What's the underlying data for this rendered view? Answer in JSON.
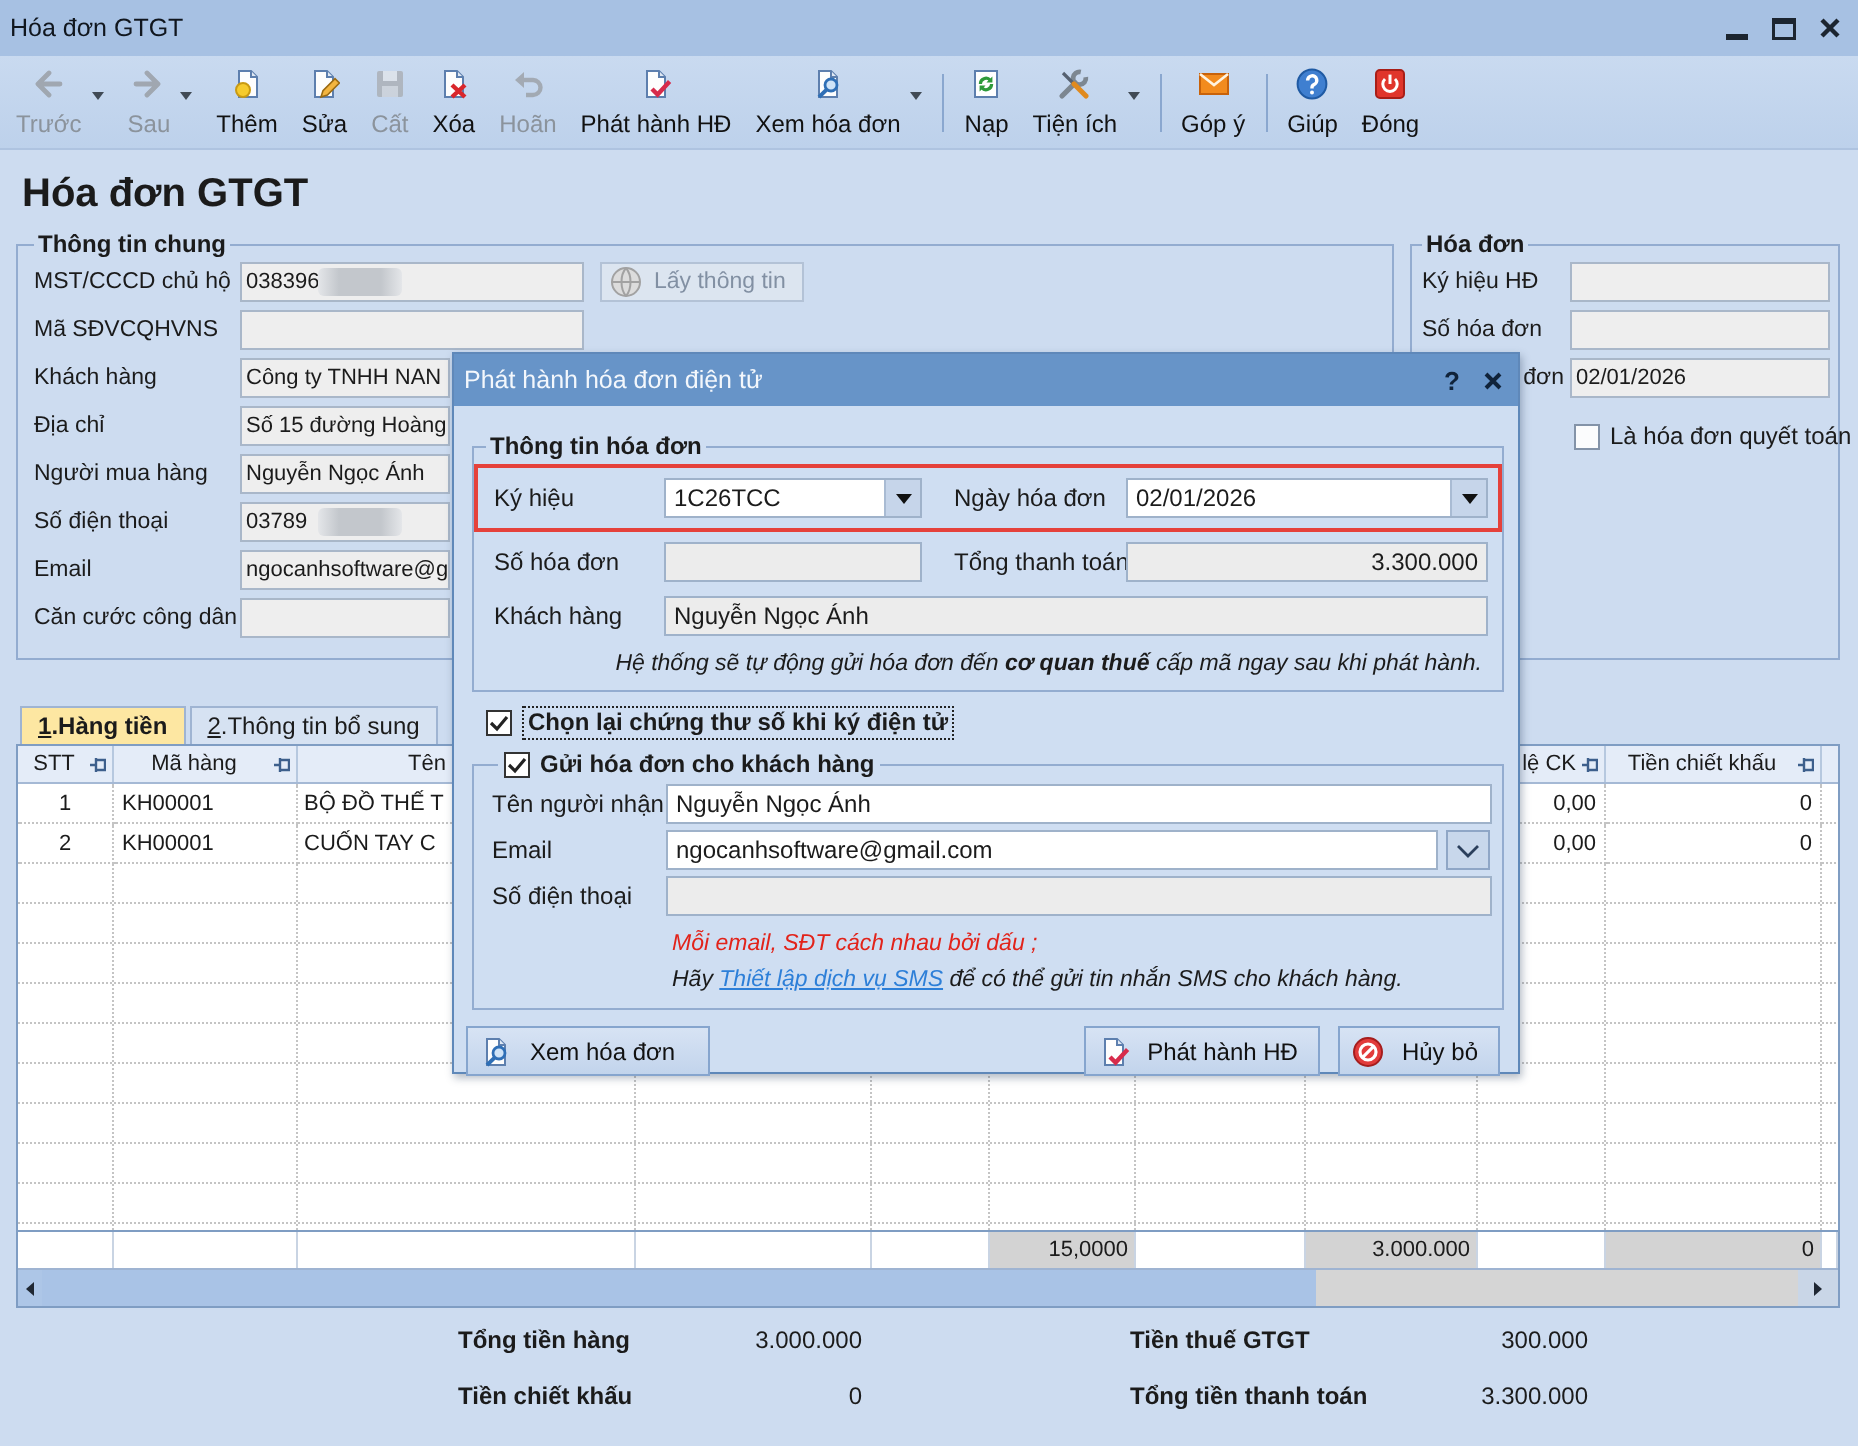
{
  "window": {
    "title": "Hóa đơn GTGT"
  },
  "toolbar": {
    "groups": [
      [
        {
          "label": "Trước",
          "disabled": true,
          "dropdown": true
        },
        {
          "label": "Sau",
          "disabled": true,
          "dropdown": true
        },
        {
          "label": "Thêm",
          "disabled": false,
          "dropdown": false
        },
        {
          "label": "Sửa",
          "disabled": false,
          "dropdown": false
        },
        {
          "label": "Cất",
          "disabled": true,
          "dropdown": false
        },
        {
          "label": "Xóa",
          "disabled": false,
          "dropdown": false
        },
        {
          "label": "Hoãn",
          "disabled": true,
          "dropdown": false
        },
        {
          "label": "Phát hành HĐ",
          "disabled": false,
          "dropdown": false
        },
        {
          "label": "Xem hóa đơn",
          "disabled": false,
          "dropdown": true
        }
      ],
      [
        {
          "label": "Nạp",
          "disabled": false,
          "dropdown": false
        },
        {
          "label": "Tiện ích",
          "disabled": false,
          "dropdown": true
        }
      ],
      [
        {
          "label": "Góp ý",
          "disabled": false,
          "dropdown": false
        }
      ],
      [
        {
          "label": "Giúp",
          "disabled": false,
          "dropdown": false
        },
        {
          "label": "Đóng",
          "disabled": false,
          "dropdown": false
        }
      ]
    ]
  },
  "page_title": "Hóa đơn GTGT",
  "general_info": {
    "title": "Thông tin chung",
    "fields": [
      {
        "label": "MST/CCCD chủ hộ",
        "value": "038396",
        "redacted": true
      },
      {
        "label": "Mã SĐVCQHVNS",
        "redacted": false
      },
      {
        "label": "Khách hàng",
        "value": "Công ty TNHH NAN",
        "redacted": false
      },
      {
        "label": "Địa chỉ",
        "value": "Số 15 đường Hoàng",
        "redacted": false
      },
      {
        "label": "Người mua hàng",
        "value": "Nguyễn Ngọc Ánh",
        "redacted": false
      },
      {
        "label": "Số điện thoại",
        "value": "03789",
        "redacted": true
      },
      {
        "label": "Email",
        "value": "ngocanhsoftware@g",
        "redacted": false
      },
      {
        "label": "Căn cước công dân",
        "redacted": false
      }
    ],
    "fetch_button": {
      "label": "Lấy thông tin",
      "disabled": true
    }
  },
  "invoice_info": {
    "title": "Hóa đơn",
    "fields": [
      {
        "label": "Ký hiệu HĐ"
      },
      {
        "label": "Số hóa đơn"
      },
      {
        "label": "đơn",
        "value": "02/01/2026"
      }
    ],
    "final_invoice": {
      "label": "Là hóa đơn quyết toán",
      "checked": false
    }
  },
  "tabs": [
    {
      "label": "1.Hàng tiền",
      "selected": true
    },
    {
      "label": "2.Thông tin bổ sung",
      "selected": false
    }
  ],
  "table": {
    "columns": [
      {
        "label": "STT"
      },
      {
        "label": "Mã hàng"
      },
      {
        "label": "Tên"
      },
      {},
      {},
      {},
      {},
      {},
      {
        "label": "lệ CK"
      },
      {
        "label": "Tiền chiết khấu"
      }
    ],
    "rows": [
      {
        "cells": [
          "1",
          "KH00001",
          "BỘ ĐỒ THẾ T"
        ],
        "trailing_cells": [
          "0,00",
          "0"
        ]
      },
      {
        "cells": [
          "2",
          "KH00001",
          "CUỐN TAY C"
        ],
        "trailing_cells": [
          "0,00",
          "0"
        ]
      }
    ],
    "footer": [
      {
        "kind": "blank"
      },
      {
        "kind": "blank"
      },
      {
        "kind": "blank"
      },
      {
        "kind": "blank"
      },
      {
        "kind": "blank"
      },
      {
        "kind": "total",
        "value": "15,0000"
      },
      {
        "kind": "blank"
      },
      {
        "kind": "total",
        "value": "3.000.000"
      },
      {
        "kind": "blank"
      },
      {
        "kind": "total",
        "value": "0"
      }
    ]
  },
  "totals": [
    {
      "label": "Tổng tiền hàng",
      "value": "3.000.000"
    },
    {
      "label": "Tiền thuế GTGT",
      "value": "300.000"
    },
    {
      "label": "Tiền chiết khấu",
      "value": "0"
    },
    {
      "label": "Tổng tiền thanh toán",
      "value": "3.300.000"
    }
  ],
  "dialog": {
    "title": "Phát hành hóa đơn điện tử",
    "help_label": "?",
    "invoice_group": {
      "title": "Thông tin hóa đơn",
      "rows": [
        {
          "highlighted": true,
          "fields": [
            {
              "kind": "combo",
              "label": "Ký hiệu",
              "value": "1C26TCC"
            },
            {
              "kind": "combo",
              "label": "Ngày hóa đơn",
              "value": "02/01/2026"
            }
          ]
        },
        {
          "highlighted": false,
          "fields": [
            {
              "kind": "readonly",
              "label": "Số hóa đơn"
            },
            {
              "kind": "amount",
              "label": "Tổng thanh toán",
              "value": "3.300.000"
            }
          ]
        },
        {
          "highlighted": false,
          "fields": [
            {
              "kind": "readonly",
              "label": "Khách hàng",
              "value": "Nguyễn Ngọc Ánh"
            }
          ]
        }
      ],
      "note": "Hệ thống sẽ tự động gửi hóa đơn đến **cơ quan thuế** cấp mã ngay sau khi phát hành."
    },
    "reselect_cert": {
      "label": "Chọn lại chứng thư số khi ký điện tử",
      "checked": true
    },
    "send_group": {
      "label": "Gửi hóa đơn cho khách hàng",
      "checked": true,
      "fields": [
        {
          "kind": "input",
          "label": "Tên người nhận",
          "value": "Nguyễn Ngọc Ánh"
        },
        {
          "kind": "email",
          "label": "Email",
          "value": "ngocanhsoftware@gmail.com"
        },
        {
          "kind": "readonly",
          "label": "Số điện thoại"
        }
      ],
      "warning": "Mỗi email, SĐT cách nhau bởi dấu ;",
      "sms_hint": {
        "before": "Hãy",
        "link": "Thiết lập dịch vụ SMS",
        "after": "để có thể gửi tin nhắn SMS cho khách hàng."
      }
    },
    "buttons": [
      {
        "label": "Xem hóa đơn"
      },
      {
        "label": "Phát hành HĐ"
      },
      {
        "label": "Hủy bỏ"
      }
    ]
  }
}
